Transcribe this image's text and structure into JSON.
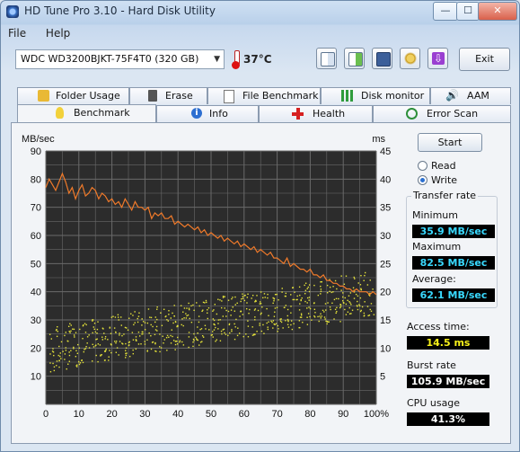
{
  "window": {
    "title": "HD Tune Pro 3.10 - Hard Disk Utility"
  },
  "title_buttons": {
    "minimize": "—",
    "maximize": "☐",
    "close": "✕"
  },
  "menu": [
    "File",
    "Help"
  ],
  "toolbar": {
    "drive": "WDC WD3200BJKT-75F4T0 (320 GB)",
    "temperature": "37°C",
    "exit_label": "Exit",
    "buttons": [
      "copy-text-icon",
      "copy-screenshot-icon",
      "save-icon",
      "options-icon",
      "download-icon"
    ]
  },
  "tabs_top": [
    "Folder Usage",
    "Erase",
    "File Benchmark",
    "Disk monitor",
    "AAM"
  ],
  "tabs_bottom": [
    "Benchmark",
    "Info",
    "Health",
    "Error Scan"
  ],
  "active_tab": "Benchmark",
  "side": {
    "start_label": "Start",
    "read_label": "Read",
    "write_label": "Write",
    "selected_mode": "Write",
    "transfer_rate_title": "Transfer rate",
    "minimum_label": "Minimum",
    "minimum_value": "35.9 MB/sec",
    "maximum_label": "Maximum",
    "maximum_value": "82.5 MB/sec",
    "average_label": "Average:",
    "average_value": "62.1 MB/sec",
    "access_time_label": "Access time:",
    "access_time_value": "14.5 ms",
    "burst_rate_label": "Burst rate",
    "burst_rate_value": "105.9 MB/sec",
    "cpu_usage_label": "CPU usage",
    "cpu_usage_value": "41.3%"
  },
  "chart_data": {
    "type": "line",
    "left_axis_label": "MB/sec",
    "right_axis_label": "ms",
    "y_left_ticks": [
      90,
      80,
      70,
      60,
      50,
      40,
      30,
      20,
      10
    ],
    "y_right_ticks": [
      45,
      40,
      35,
      30,
      25,
      20,
      15,
      10,
      5
    ],
    "x_ticks": [
      "0",
      "10",
      "20",
      "30",
      "40",
      "50",
      "60",
      "70",
      "80",
      "90",
      "100%"
    ],
    "ylim_left": [
      0,
      90
    ],
    "ylim_right": [
      0,
      45
    ],
    "xlim": [
      0,
      100
    ],
    "grid": true,
    "colors": {
      "transfer": "#f07a2a",
      "access": "#e6e43a",
      "background": "#2c2c2c",
      "grid": "#6a6a6a"
    },
    "series": [
      {
        "role": "transfer rate",
        "axis": "left",
        "x": [
          0,
          1,
          2,
          3,
          4,
          5,
          6,
          7,
          8,
          9,
          10,
          11,
          12,
          13,
          14,
          15,
          16,
          17,
          18,
          19,
          20,
          21,
          22,
          23,
          24,
          25,
          26,
          27,
          28,
          29,
          30,
          31,
          32,
          33,
          34,
          35,
          36,
          37,
          38,
          39,
          40,
          41,
          42,
          43,
          44,
          45,
          46,
          47,
          48,
          49,
          50,
          51,
          52,
          53,
          54,
          55,
          56,
          57,
          58,
          59,
          60,
          61,
          62,
          63,
          64,
          65,
          66,
          67,
          68,
          69,
          70,
          71,
          72,
          73,
          74,
          75,
          76,
          77,
          78,
          79,
          80,
          81,
          82,
          83,
          84,
          85,
          86,
          87,
          88,
          89,
          90,
          91,
          92,
          93,
          94,
          95,
          96,
          97,
          98,
          99,
          100
        ],
        "y": [
          77,
          80,
          78,
          76,
          79,
          82,
          79,
          75,
          77,
          73,
          76,
          78,
          74,
          75,
          77,
          76,
          73,
          75,
          74,
          72,
          73,
          71,
          72,
          70,
          73,
          71,
          69,
          72,
          70,
          70,
          69,
          70,
          66,
          68,
          67,
          68,
          66,
          66,
          67,
          64,
          65,
          64,
          63,
          64,
          63,
          62,
          63,
          61,
          62,
          60,
          61,
          60,
          59,
          60,
          58,
          59,
          58,
          57,
          58,
          56,
          57,
          56,
          55,
          56,
          54,
          55,
          54,
          53,
          54,
          52,
          52,
          51,
          50,
          52,
          49,
          50,
          49,
          48,
          48,
          47,
          48,
          46,
          46,
          45,
          46,
          44,
          44,
          43,
          43,
          42,
          42,
          41,
          41,
          40,
          41,
          40,
          40,
          40,
          39,
          40,
          39
        ]
      },
      {
        "role": "access time",
        "axis": "right",
        "x": [
          2,
          4,
          6,
          8,
          10,
          12,
          14,
          16,
          18,
          20,
          22,
          24,
          26,
          28,
          30,
          32,
          34,
          36,
          38,
          40,
          42,
          44,
          46,
          48,
          50,
          52,
          54,
          56,
          58,
          60,
          62,
          64,
          66,
          68,
          70,
          72,
          74,
          76,
          78,
          80,
          82,
          84,
          86,
          88,
          90,
          92,
          94,
          96,
          98
        ],
        "y": [
          9.5,
          10,
          10.2,
          10.5,
          10.8,
          11,
          11.2,
          11.5,
          11.7,
          12,
          12.2,
          12.4,
          12.6,
          12.8,
          13,
          13.2,
          13.4,
          13.6,
          13.8,
          14,
          14.2,
          14.4,
          14.6,
          14.8,
          15,
          15.2,
          15.4,
          15.6,
          15.8,
          16,
          16.2,
          16.4,
          16.6,
          16.8,
          17,
          17.2,
          17.4,
          17.6,
          17.8,
          18,
          18.2,
          18.4,
          18.6,
          18.8,
          19,
          19.2,
          19.4,
          19.6,
          19.8
        ]
      }
    ]
  }
}
